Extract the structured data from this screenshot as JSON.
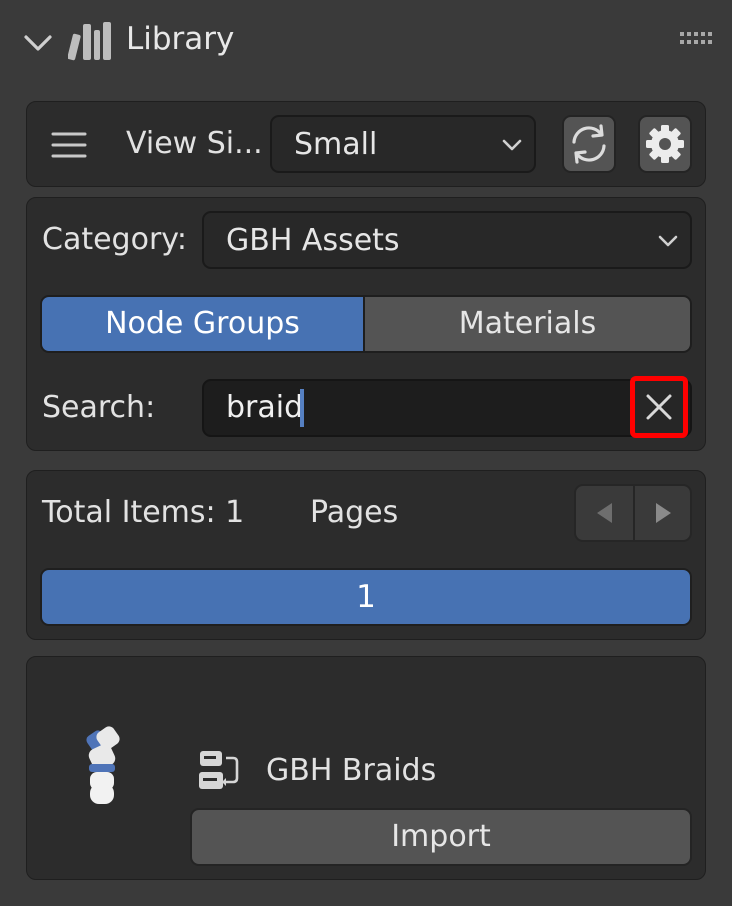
{
  "header": {
    "title": "Library",
    "collapse_icon": "chevron-down-icon",
    "books_icon": "books-icon",
    "grip_icon": "drag-grip-icon"
  },
  "toolbar": {
    "menu_icon": "hamburger-menu-icon",
    "view_size_label": "View Si...",
    "view_size_value": "Small",
    "refresh_icon": "refresh-icon",
    "settings_icon": "gear-icon"
  },
  "filters": {
    "category_label": "Category:",
    "category_value": "GBH Assets",
    "tabs": [
      {
        "label": "Node Groups",
        "active": true
      },
      {
        "label": "Materials",
        "active": false
      }
    ],
    "search_label": "Search:",
    "search_value": "braid",
    "clear_icon": "close-icon"
  },
  "pagination": {
    "total_items_label": "Total Items: 1",
    "pages_label": "Pages",
    "prev_icon": "triangle-left-icon",
    "next_icon": "triangle-right-icon",
    "current_page": "1"
  },
  "results": [
    {
      "preview_icon": "braid-preview-icon",
      "type_icon": "node-group-icon",
      "name": "GBH Braids",
      "import_label": "Import"
    }
  ],
  "colors": {
    "accent": "#4772b3",
    "highlight": "#ff0000",
    "panel": "#2c2c2c",
    "background": "#3a3a3a"
  }
}
